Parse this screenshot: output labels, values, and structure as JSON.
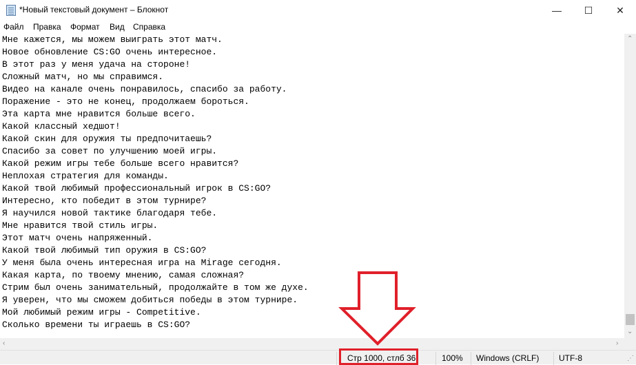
{
  "window": {
    "title": "*Новый текстовый документ – Блокнот",
    "minimize": "—",
    "maximize": "☐",
    "close": "✕"
  },
  "menu": [
    "Файл",
    "Правка",
    "Формат",
    "Вид",
    "Справка"
  ],
  "lines": [
    "Мне кажется, мы можем выиграть этот матч.",
    "Новое обновление CS:GO очень интересное.",
    "В этот раз у меня удача на стороне!",
    "Сложный матч, но мы справимся.",
    "Видео на канале очень понравилось, спасибо за работу.",
    "Поражение - это не конец, продолжаем бороться.",
    "Эта карта мне нравится больше всего.",
    "Какой классный хедшот!",
    "Какой скин для оружия ты предпочитаешь?",
    "Спасибо за совет по улучшению моей игры.",
    "Какой режим игры тебе больше всего нравится?",
    "Неплохая стратегия для команды.",
    "Какой твой любимый профессиональный игрок в CS:GO?",
    "Интересно, кто победит в этом турнире?",
    "Я научился новой тактике благодаря тебе.",
    "Мне нравится твой стиль игры.",
    "Этот матч очень напряженный.",
    "Какой твой любимый тип оружия в CS:GO?",
    "У меня была очень интересная игра на Mirage сегодня.",
    "Какая карта, по твоему мнению, самая сложная?",
    "Стрим был очень занимательный, продолжайте в том же духе.",
    "Я уверен, что мы сможем добиться победы в этом турнире.",
    "Мой любимый режим игры - Competitive.",
    "Сколько времени ты играешь в CS:GO?"
  ],
  "status": {
    "position": "Стр 1000, стлб 36",
    "zoom": "100%",
    "line_endings": "Windows (CRLF)",
    "encoding": "UTF-8"
  },
  "colors": {
    "annotation": "#e0202a"
  }
}
